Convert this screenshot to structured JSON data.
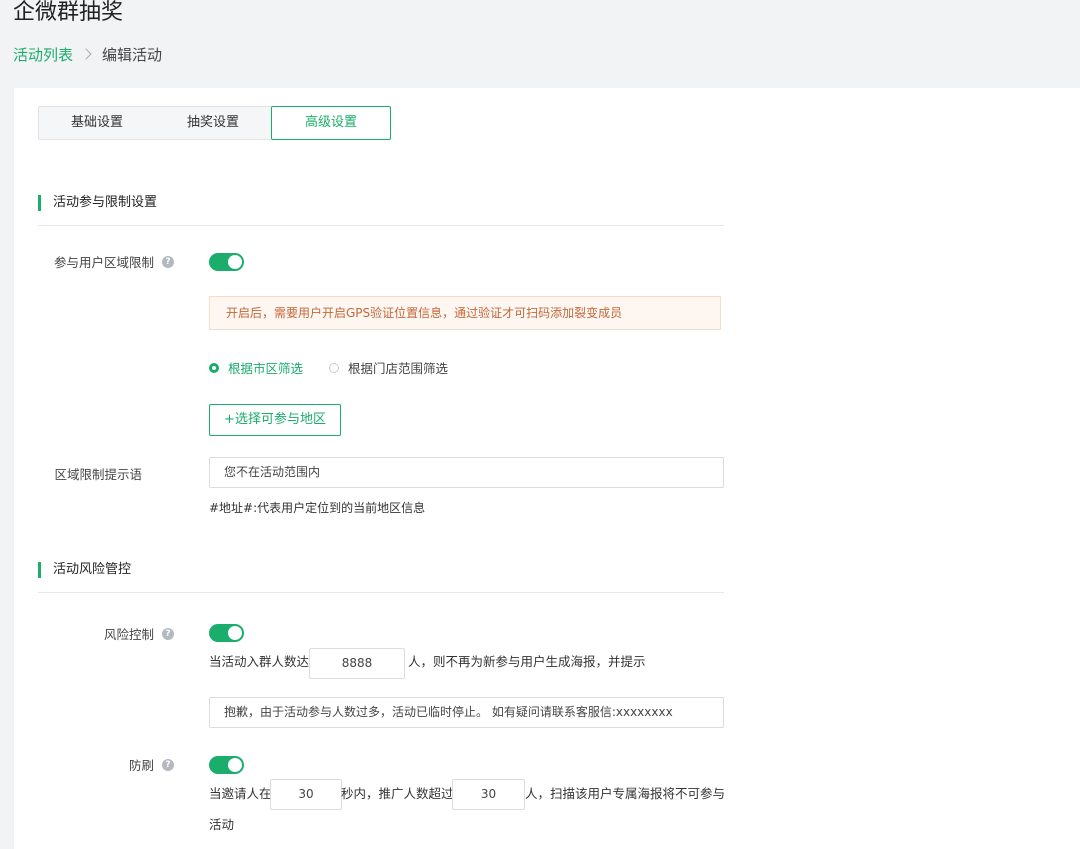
{
  "page": {
    "title": "企微群抽奖",
    "breadcrumb": {
      "list": "活动列表",
      "current": "编辑活动"
    }
  },
  "tabs": [
    {
      "label": "基础设置",
      "active": false
    },
    {
      "label": "抽奖设置",
      "active": false
    },
    {
      "label": "高级设置",
      "active": true
    }
  ],
  "participation": {
    "section_title": "活动参与限制设置",
    "region_limit": {
      "label": "参与用户区域限制",
      "enabled": true,
      "notice": "开启后，需要用户开启GPS验证位置信息，通过验证才可扫码添加裂变成员",
      "options": [
        {
          "label": "根据市区筛选",
          "checked": true
        },
        {
          "label": "根据门店范围筛选",
          "checked": false
        }
      ],
      "add_button": "+选择可参与地区"
    },
    "prompt": {
      "label": "区域限制提示语",
      "value": "您不在活动范围内",
      "hint": "#地址#:代表用户定位到的当前地区信息"
    }
  },
  "risk": {
    "section_title": "活动风险管控",
    "risk_control": {
      "label": "风险控制",
      "enabled": true,
      "text_before": "当活动入群人数达",
      "count": "8888",
      "text_after": "人，则不再为新参与用户生成海报，并提示",
      "message": "抱歉，由于活动参与人数过多，活动已临时停止。 如有疑问请联系客服信:xxxxxxxx"
    },
    "anti_brush": {
      "label": "防刷",
      "enabled": true,
      "text_1": "当邀请人在",
      "seconds": "30",
      "text_2": "秒内，推广人数超过",
      "people": "30",
      "text_3": "人，扫描该用户专属海报将不可参与",
      "text_4": "活动"
    }
  },
  "colors": {
    "accent": "#1aad6b",
    "notice_text": "#c2683a",
    "notice_bg": "#fdf6f1"
  }
}
